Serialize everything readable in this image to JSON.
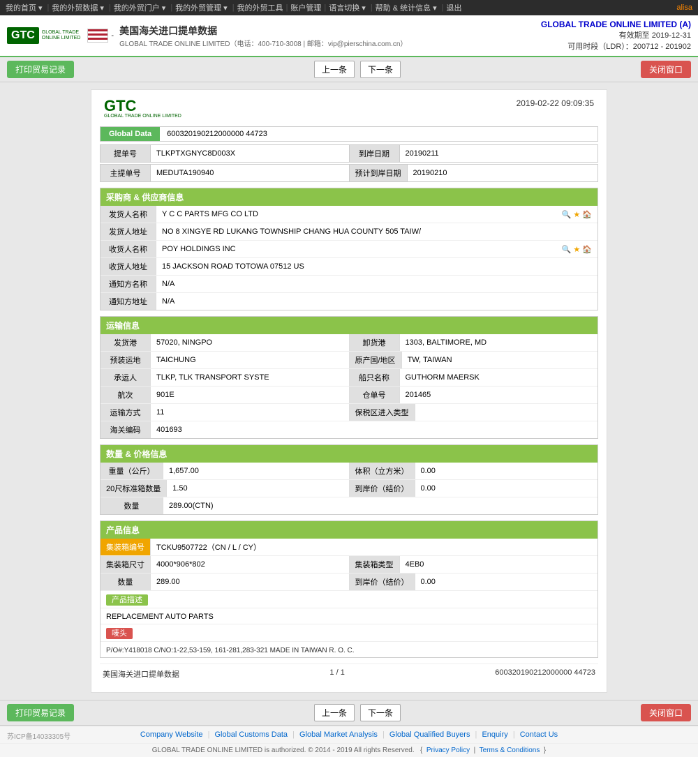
{
  "topnav": {
    "items": [
      "我的首页",
      "我的外贸数据",
      "我的外贸门户",
      "我的外贸管理",
      "我的外贸工具",
      "账户管理",
      "语言切换",
      "帮助 & 统计信息",
      "退出"
    ],
    "user": "alisa"
  },
  "header": {
    "logo_text": "GTC",
    "logo_sub": "GLOBAL TRADE ONLINE LIMITED",
    "flag_label": "美国海关进口提单数据",
    "company_full": "GLOBAL TRADE ONLINE LIMITED（电话：400-710-3008 | 邮箱：vip@pierschina.com.cn）",
    "right_company": "GLOBAL TRADE ONLINE LIMITED (A)",
    "validity": "有效期至 2019-12-31",
    "ldr": "可用时段（LDR）：200712 - 201902"
  },
  "toolbar": {
    "print_btn": "打印贸易记录",
    "prev_btn": "上一条",
    "next_btn": "下一条",
    "close_btn": "关闭窗口"
  },
  "document": {
    "logo_text": "GTC",
    "logo_sub": "GLOBAL TRADE ONLINE LIMITED",
    "datetime": "2019-02-22 09:09:35",
    "global_data_label": "Global Data",
    "global_data_value": "600320190212000000 44723",
    "bill_no_label": "提单号",
    "bill_no_value": "TLKPTXGNYC8D003X",
    "arrival_date_label": "到岸日期",
    "arrival_date_value": "20190211",
    "master_bill_label": "主提单号",
    "master_bill_value": "MEDUTA190940",
    "est_arrival_label": "预计到岸日期",
    "est_arrival_value": "20190210"
  },
  "shipper_section": {
    "title": "采购商 & 供应商信息",
    "shipper_label": "发货人名称",
    "shipper_value": "Y C C PARTS MFG CO LTD",
    "shipper_addr_label": "发货人地址",
    "shipper_addr_value": "NO 8 XINGYE RD LUKANG TOWNSHIP CHANG HUA COUNTY 505 TAIW/",
    "consignee_label": "收货人名称",
    "consignee_value": "POY HOLDINGS INC",
    "consignee_addr_label": "收货人地址",
    "consignee_addr_value": "15 JACKSON ROAD TOTOWA 07512 US",
    "notify_label": "通知方名称",
    "notify_value": "N/A",
    "notify_addr_label": "通知方地址",
    "notify_addr_value": "N/A"
  },
  "transport_section": {
    "title": "运输信息",
    "origin_port_label": "发货港",
    "origin_port_value": "57020, NINGPO",
    "dest_port_label": "卸货港",
    "dest_port_value": "1303, BALTIMORE, MD",
    "pre_load_label": "预装运地",
    "pre_load_value": "TAICHUNG",
    "origin_country_label": "原产国/地区",
    "origin_country_value": "TW, TAIWAN",
    "carrier_label": "承运人",
    "carrier_value": "TLKP, TLK TRANSPORT SYSTE",
    "vessel_label": "船只名称",
    "vessel_value": "GUTHORM MAERSK",
    "voyage_label": "航次",
    "voyage_value": "901E",
    "warehouse_label": "仓单号",
    "warehouse_value": "201465",
    "transport_mode_label": "运输方式",
    "transport_mode_value": "11",
    "ftz_label": "保税区进入类型",
    "ftz_value": "",
    "customs_label": "海关编码",
    "customs_value": "401693"
  },
  "quantity_section": {
    "title": "数量 & 价格信息",
    "weight_label": "重量（公斤）",
    "weight_value": "1,657.00",
    "volume_label": "体积（立方米）",
    "volume_value": "0.00",
    "container20_label": "20尺标准箱数量",
    "container20_value": "1.50",
    "arrival_price_label": "到岸价（结价）",
    "arrival_price_value": "0.00",
    "quantity_label": "数量",
    "quantity_value": "289.00(CTN)"
  },
  "product_section": {
    "title": "产品信息",
    "container_no_label": "集装箱编号",
    "container_no_value": "TCKU9507722（CN / L / CY）",
    "container_size_label": "集装箱尺寸",
    "container_size_value": "4000*906*802",
    "container_type_label": "集装箱类型",
    "container_type_value": "4EB0",
    "quantity_label": "数量",
    "quantity_value": "289.00",
    "arrival_price_label": "到岸价（结价）",
    "arrival_price_value": "0.00",
    "product_desc_label": "产品描述",
    "product_desc_value": "REPLACEMENT AUTO PARTS",
    "marks_label": "唛头",
    "marks_value": "P/O#:Y418018 C/NO:1-22,53-159, 161-281,283-321 MADE IN TAIWAN R. O. C."
  },
  "doc_footer": {
    "source": "美国海关进口提单数据",
    "page": "1 / 1",
    "id": "600320190212000000 44723"
  },
  "bottom_toolbar": {
    "print_btn": "打印贸易记录",
    "prev_btn": "上一条",
    "next_btn": "下一条",
    "close_btn": "关闭窗口"
  },
  "footer": {
    "icp": "苏ICP备14033305号",
    "links": [
      "Company Website",
      "Global Customs Data",
      "Global Market Analysis",
      "Global Qualified Buyers",
      "Enquiry",
      "Contact Us"
    ],
    "copy": "GLOBAL TRADE ONLINE LIMITED is authorized. © 2014 - 2019 All rights Reserved.",
    "privacy": "Privacy Policy",
    "terms": "Terms & Conditions"
  }
}
